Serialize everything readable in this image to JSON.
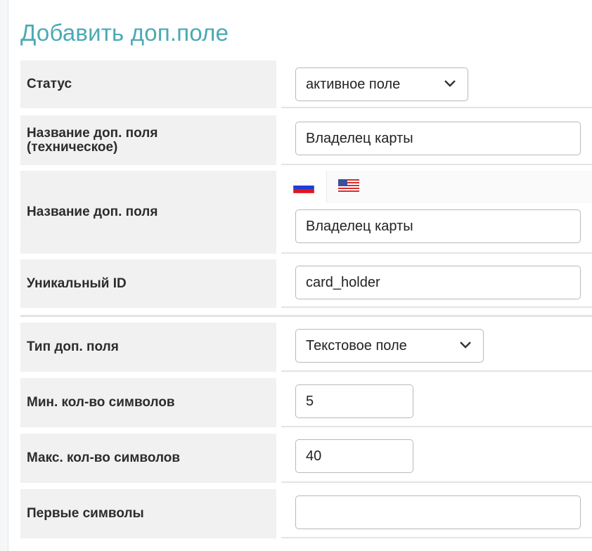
{
  "title": "Добавить доп.поле",
  "form": {
    "status": {
      "label": "Статус",
      "value": "активное поле"
    },
    "tech_name": {
      "label": "Название доп. поля (техническое)",
      "value": "Владелец карты"
    },
    "name": {
      "label": "Название доп. поля",
      "value": "Владелец карты",
      "languages": [
        "ru-flag",
        "us-flag"
      ]
    },
    "unique_id": {
      "label": "Уникальный ID",
      "value": "card_holder"
    },
    "type": {
      "label": "Тип доп. поля",
      "value": "Текстовое поле"
    },
    "min_chars": {
      "label": "Мин. кол-во символов",
      "value": "5"
    },
    "max_chars": {
      "label": "Макс. кол-во символов",
      "value": "40"
    },
    "first_chars": {
      "label": "Первые символы",
      "value": ""
    }
  }
}
